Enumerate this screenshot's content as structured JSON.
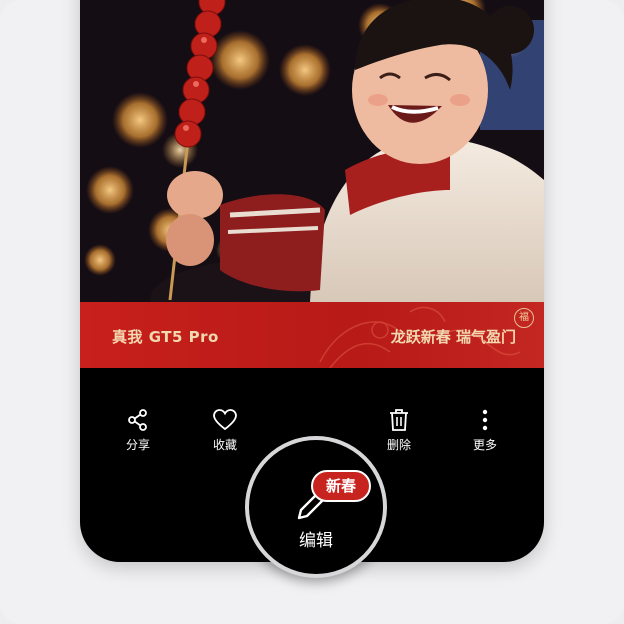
{
  "watermark": {
    "brand": "真我 GT5 Pro",
    "slogan": "龙跃新春 瑞气盈门",
    "seal": "福"
  },
  "toolbar": {
    "share_label": "分享",
    "favorite_label": "收藏",
    "edit_label": "编辑",
    "edit_badge": "新春",
    "delete_label": "删除",
    "more_label": "更多"
  },
  "colors": {
    "watermark_red": "#c8201c",
    "watermark_gold": "#f3d9b0",
    "badge_red": "#c7241f"
  },
  "icons": [
    "share-icon",
    "heart-icon",
    "pen-icon",
    "trash-icon",
    "more-vertical-icon"
  ]
}
